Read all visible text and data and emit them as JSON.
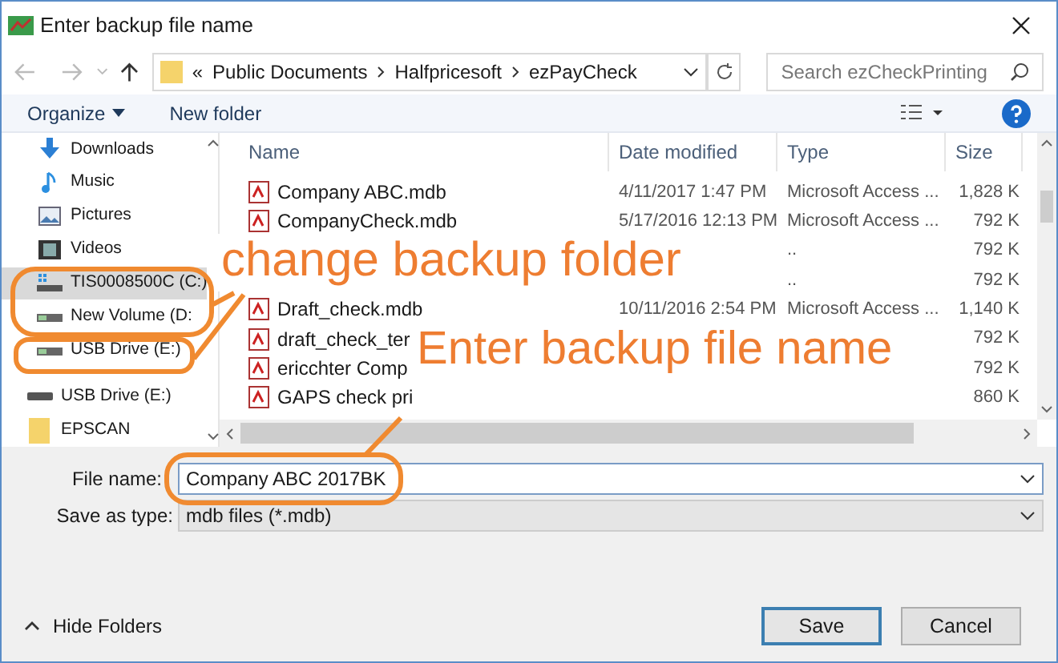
{
  "window": {
    "title": "Enter backup file name"
  },
  "address": {
    "prefix": "«",
    "path": [
      "Public Documents",
      "Halfpricesoft",
      "ezPayCheck"
    ]
  },
  "search": {
    "placeholder": "Search ezCheckPrinting"
  },
  "toolbar": {
    "organize": "Organize",
    "new_folder": "New folder"
  },
  "sidebar": {
    "items": [
      {
        "label": "Downloads",
        "kind": "downloads",
        "selected": false
      },
      {
        "label": "Music",
        "kind": "music",
        "selected": false
      },
      {
        "label": "Pictures",
        "kind": "pictures",
        "selected": false
      },
      {
        "label": "Videos",
        "kind": "videos",
        "selected": false
      },
      {
        "label": "TIS0008500C (C:)",
        "kind": "system-drive",
        "selected": true
      },
      {
        "label": "New Volume (D:",
        "kind": "drive",
        "selected": false
      },
      {
        "label": "USB Drive (E:)",
        "kind": "drive",
        "selected": false
      },
      {
        "label": "USB Drive (E:)",
        "kind": "top-drive",
        "selected": false
      },
      {
        "label": "EPSCAN",
        "kind": "folder",
        "selected": false
      }
    ]
  },
  "files": {
    "columns": [
      "Name",
      "Date modified",
      "Type",
      "Size"
    ],
    "rows": [
      {
        "name": "Company ABC.mdb",
        "date": "4/11/2017 1:47 PM",
        "type": "Microsoft Access ...",
        "size": "1,828 K"
      },
      {
        "name": "CompanyCheck.mdb",
        "date": "5/17/2016 12:13 PM",
        "type": "Microsoft Access ...",
        "size": "792 K"
      },
      {
        "type": "..",
        "size": "792 K"
      },
      {
        "type": "..",
        "size": "792 K"
      },
      {
        "name": "Draft_check.mdb",
        "date": "10/11/2016 2:54 PM",
        "type": "Microsoft Access ...",
        "size": "1,140 K"
      },
      {
        "name": "draft_check_ter",
        "size": "792 K"
      },
      {
        "name": "ericchter Comp",
        "size": "792 K"
      },
      {
        "name": "GAPS check pri",
        "size": "860 K"
      }
    ]
  },
  "form": {
    "file_name_label": "File name:",
    "file_name": "Company ABC 2017BK",
    "type_label": "Save as type:",
    "type_value": "mdb files (*.mdb)"
  },
  "hide_folders": "Hide Folders",
  "buttons": [
    {
      "label": "Save",
      "kind": "default"
    },
    {
      "label": "Cancel",
      "kind": "normal"
    }
  ],
  "annotations": [
    {
      "text": "change backup folder"
    },
    {
      "text": "Enter backup file name"
    }
  ]
}
